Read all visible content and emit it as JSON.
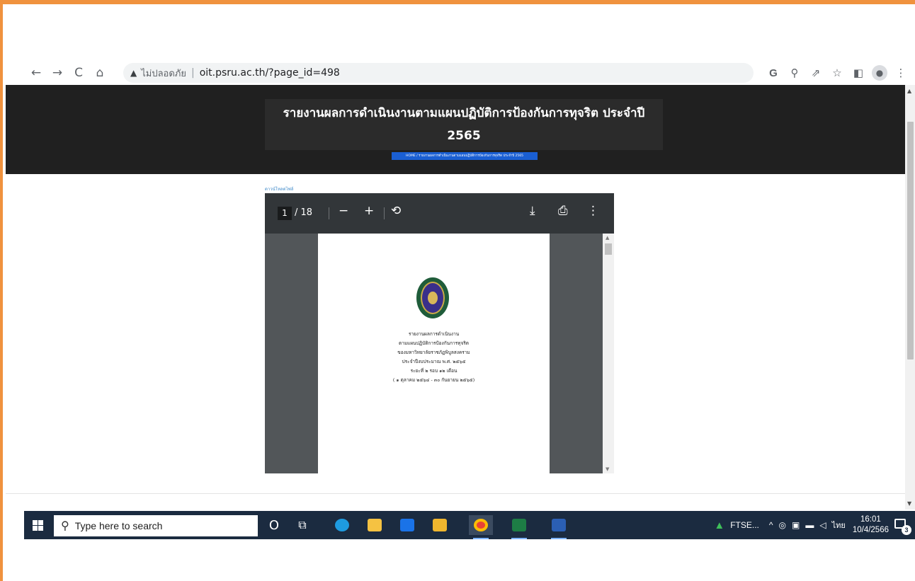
{
  "browser": {
    "back_icon": "←",
    "forward_icon": "→",
    "reload_icon": "C",
    "home_icon": "⌂",
    "security_warning_icon": "▲",
    "security_label": "ไม่ปลอดภัย",
    "url_separator": "|",
    "url": "oit.psru.ac.th/?page_id=498",
    "google_icon": "G",
    "zoom_icon": "⚲",
    "share_icon": "⇗",
    "bookmark_icon": "☆",
    "sidepanel_icon": "◧",
    "profile_icon": "●",
    "menu_icon": "⋮"
  },
  "page": {
    "title": "รายงานผลการดำเนินงานตามแผนปฏิบัติการป้องกันการทุจริต ประจำปี 2565",
    "breadcrumb": "HOME / รายงานผลการดำเนินงานตามแผนปฏิบัติการป้องกันการทุจริต ประจำปี 2565",
    "download_link": "ดาวน์โหลดไฟล์"
  },
  "pdf": {
    "current_page": "1",
    "total_pages": "/ 18",
    "zoom_out_icon": "−",
    "zoom_in_icon": "+",
    "rotate_icon": "⟲",
    "download_icon": "⤓",
    "print_icon": "⎙",
    "more_icon": "⋮",
    "scroll_up_icon": "▲",
    "scroll_down_icon": "▼",
    "document_lines": [
      "รายงานผลการดำเนินงาน",
      "ตามแผนปฏิบัติการป้องกันการทุจริต",
      "ของมหาวิทยาลัยราชภัฏพิบูลสงคราม",
      "ประจำปีงบประมาณ พ.ศ. ๒๕๖๕",
      "ระยะที่ ๒ รอบ ๑๒ เดือน",
      "( ๑ ตุลาคม ๒๕๖๔ - ๓๐ กันยายน ๒๕๖๕)"
    ]
  },
  "taskbar": {
    "search_placeholder": "Type here to search",
    "search_icon": "⚲",
    "cortana_icon": "O",
    "task_view_icon": "⧉",
    "stock_label": "FTSE...",
    "tray_chevron": "^",
    "language": "ไทย",
    "time": "16:01",
    "date": "10/4/2566",
    "notification_count": "3",
    "colors": {
      "edge": "#1e9be0",
      "explorer": "#f5c242",
      "mail": "#1a73e8",
      "store": "#f0b62e",
      "chrome": "#e94235",
      "excel": "#1d7d45",
      "word": "#2b5fb4"
    }
  }
}
